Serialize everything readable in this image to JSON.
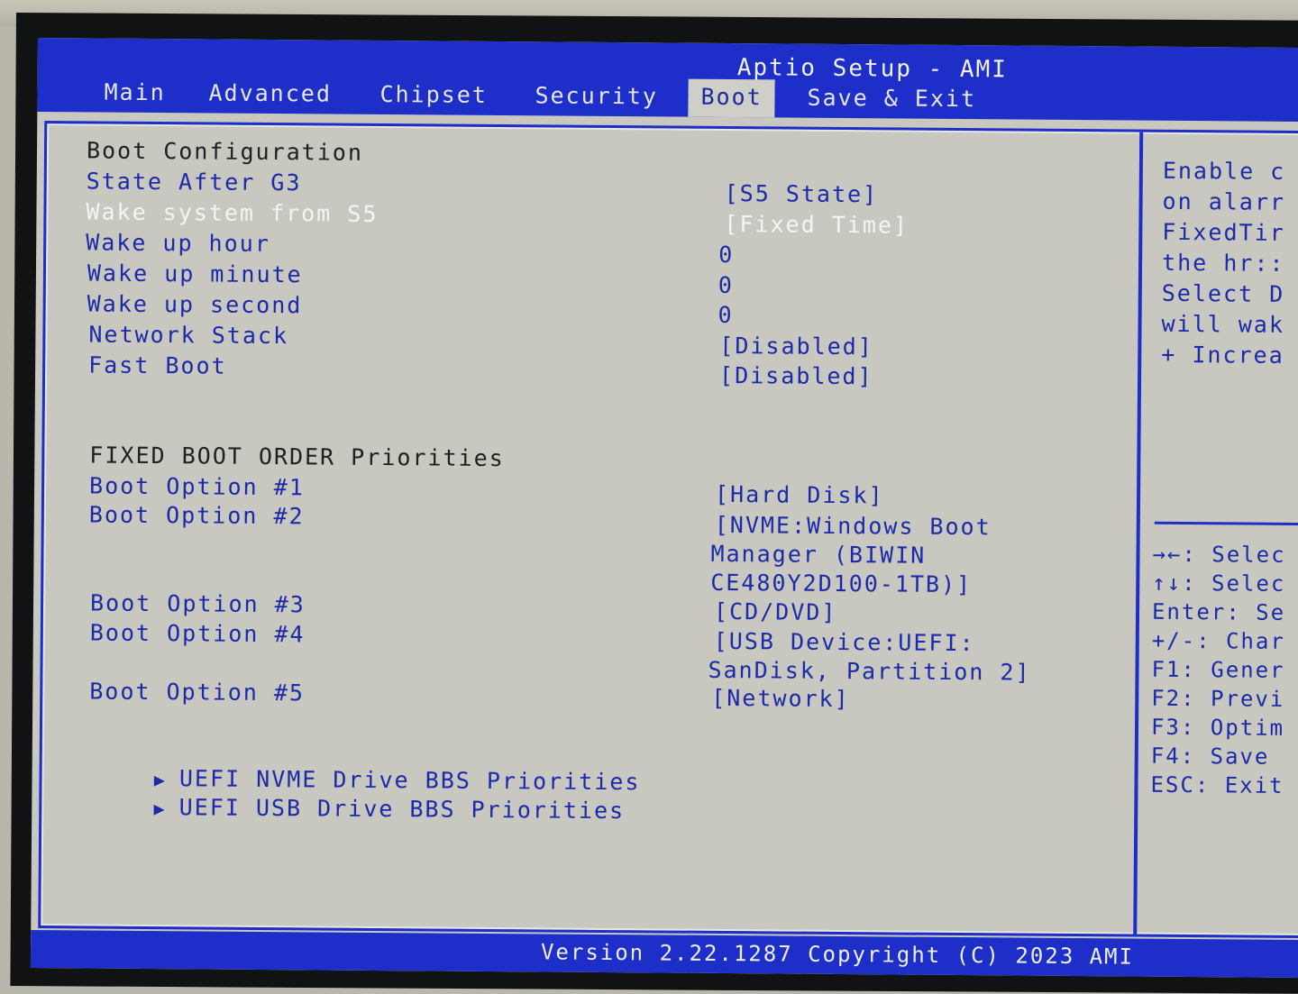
{
  "header": {
    "title": "Aptio Setup - AMI",
    "tabs": [
      {
        "label": "Main",
        "active": false
      },
      {
        "label": "Advanced",
        "active": false
      },
      {
        "label": "Chipset",
        "active": false
      },
      {
        "label": "Security",
        "active": false
      },
      {
        "label": "Boot",
        "active": true
      },
      {
        "label": "Save & Exit",
        "active": false
      }
    ]
  },
  "main": {
    "section1_title": "Boot Configuration",
    "settings": [
      {
        "label": "State After G3",
        "value": "[S5 State]"
      },
      {
        "label": "Wake system from S5",
        "value": "[Fixed Time]",
        "selected": true
      },
      {
        "label": "Wake up hour",
        "value": "0"
      },
      {
        "label": "Wake up minute",
        "value": "0"
      },
      {
        "label": "Wake up second",
        "value": "0"
      },
      {
        "label": "Network Stack",
        "value": "[Disabled]"
      },
      {
        "label": "Fast Boot",
        "value": "[Disabled]"
      }
    ],
    "section2_title": "FIXED BOOT ORDER Priorities",
    "boot_options": [
      {
        "label": "Boot Option #1",
        "value_lines": [
          "[Hard Disk]"
        ]
      },
      {
        "label": "Boot Option #2",
        "value_lines": [
          "[NVME:Windows Boot",
          "Manager (BIWIN",
          "CE480Y2D100-1TB)]"
        ]
      },
      {
        "label": "Boot Option #3",
        "value_lines": [
          "[CD/DVD]"
        ]
      },
      {
        "label": "Boot Option #4",
        "value_lines": [
          "[USB Device:UEFI:",
          "SanDisk, Partition 2]"
        ]
      },
      {
        "label": "Boot Option #5",
        "value_lines": [
          "[Network]"
        ]
      }
    ],
    "submenus": [
      {
        "label": "UEFI NVME Drive BBS Priorities",
        "icon": "triangle-right-icon"
      },
      {
        "label": "UEFI USB Drive BBS Priorities",
        "icon": "triangle-right-icon"
      }
    ]
  },
  "help_panel": {
    "lines": [
      "Enable or disable system wake",
      "on alarm event. Select",
      "FixedTime, system will wake on",
      "the hr::min::sec specified.",
      "Select DynamicTime, System",
      "will wake on the current time",
      "+ Increase minute(s)"
    ],
    "visible_lines": [
      "Enable c",
      "on alarr",
      "FixedTir",
      "the hr::",
      "Select D",
      "will wak",
      "+ Increa"
    ],
    "keys": [
      "→←: Selec",
      "↑↓: Selec",
      "Enter: Se",
      "+/-: Char",
      "F1: Gener",
      "F2: Previ",
      "F3: Optim",
      "F4: Save ",
      "ESC: Exit"
    ]
  },
  "footer": {
    "version": "Version 2.22.1287 Copyright (C) 2023 AMI"
  },
  "colors": {
    "accent_blue": "#1d2fc8",
    "panel_bg": "#c9c8c0",
    "label_text": "#1a2aa8",
    "selected_text": "#f4f4f4"
  }
}
